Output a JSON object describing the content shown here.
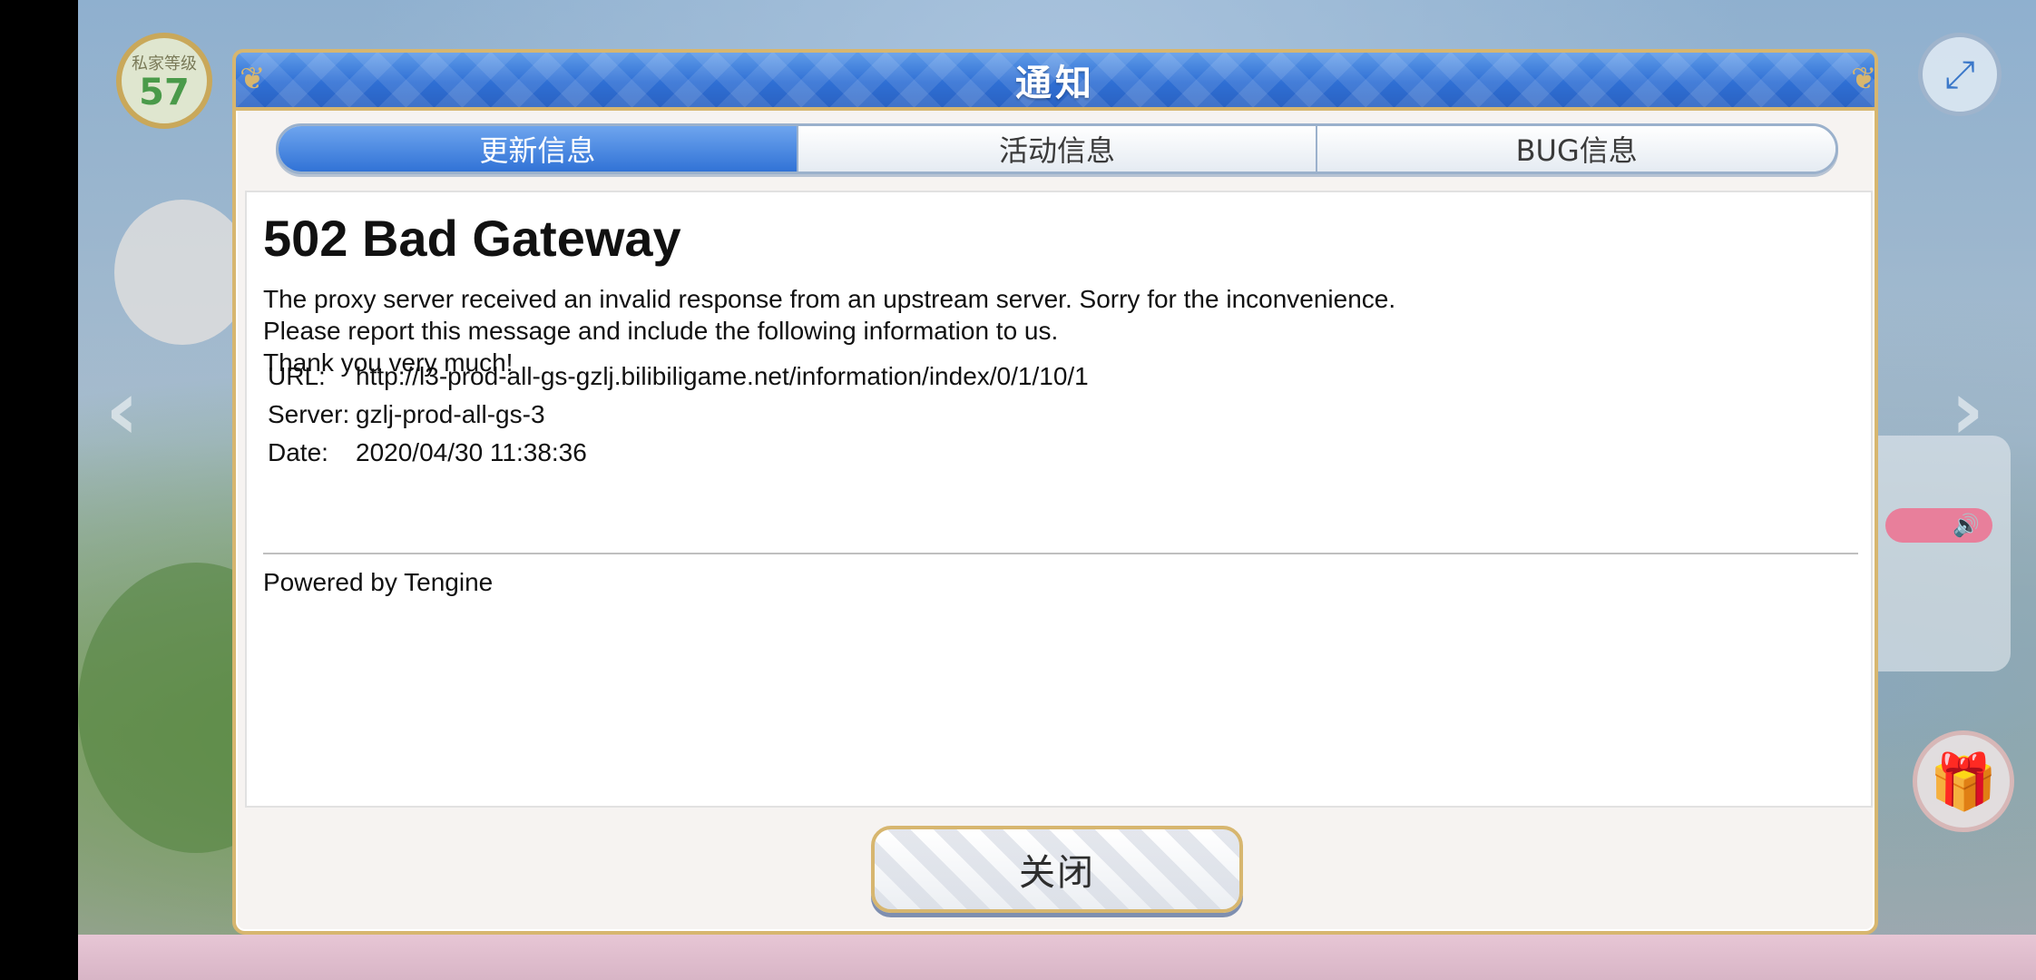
{
  "background": {
    "level_label": "私家等级",
    "level_value": "57"
  },
  "dialog": {
    "title": "通知",
    "tabs": [
      {
        "label": "更新信息",
        "active": true
      },
      {
        "label": "活动信息",
        "active": false
      },
      {
        "label": "BUG信息",
        "active": false
      }
    ],
    "error": {
      "heading": "502 Bad Gateway",
      "lines": [
        "The proxy server received an invalid response from an upstream server. Sorry for the inconvenience.",
        "Please report this message and include the following information to us.",
        "Thank you very much!"
      ],
      "info": {
        "url_label": "URL:",
        "url_value": "http://l3-prod-all-gs-gzlj.bilibiligame.net/information/index/0/1/10/1",
        "server_label": "Server:",
        "server_value": "gzlj-prod-all-gs-3",
        "date_label": "Date:",
        "date_value": "2020/04/30 11:38:36"
      },
      "footer": "Powered by Tengine"
    },
    "close_label": "关闭"
  },
  "colors": {
    "header_blue": "#2f6fd4",
    "tab_active": "#3173d6",
    "gold_border": "#d7b66f"
  },
  "icons": [
    "expand-icon",
    "gift-icon",
    "speaker-icon",
    "left-arrow-icon",
    "right-arrow-icon"
  ]
}
